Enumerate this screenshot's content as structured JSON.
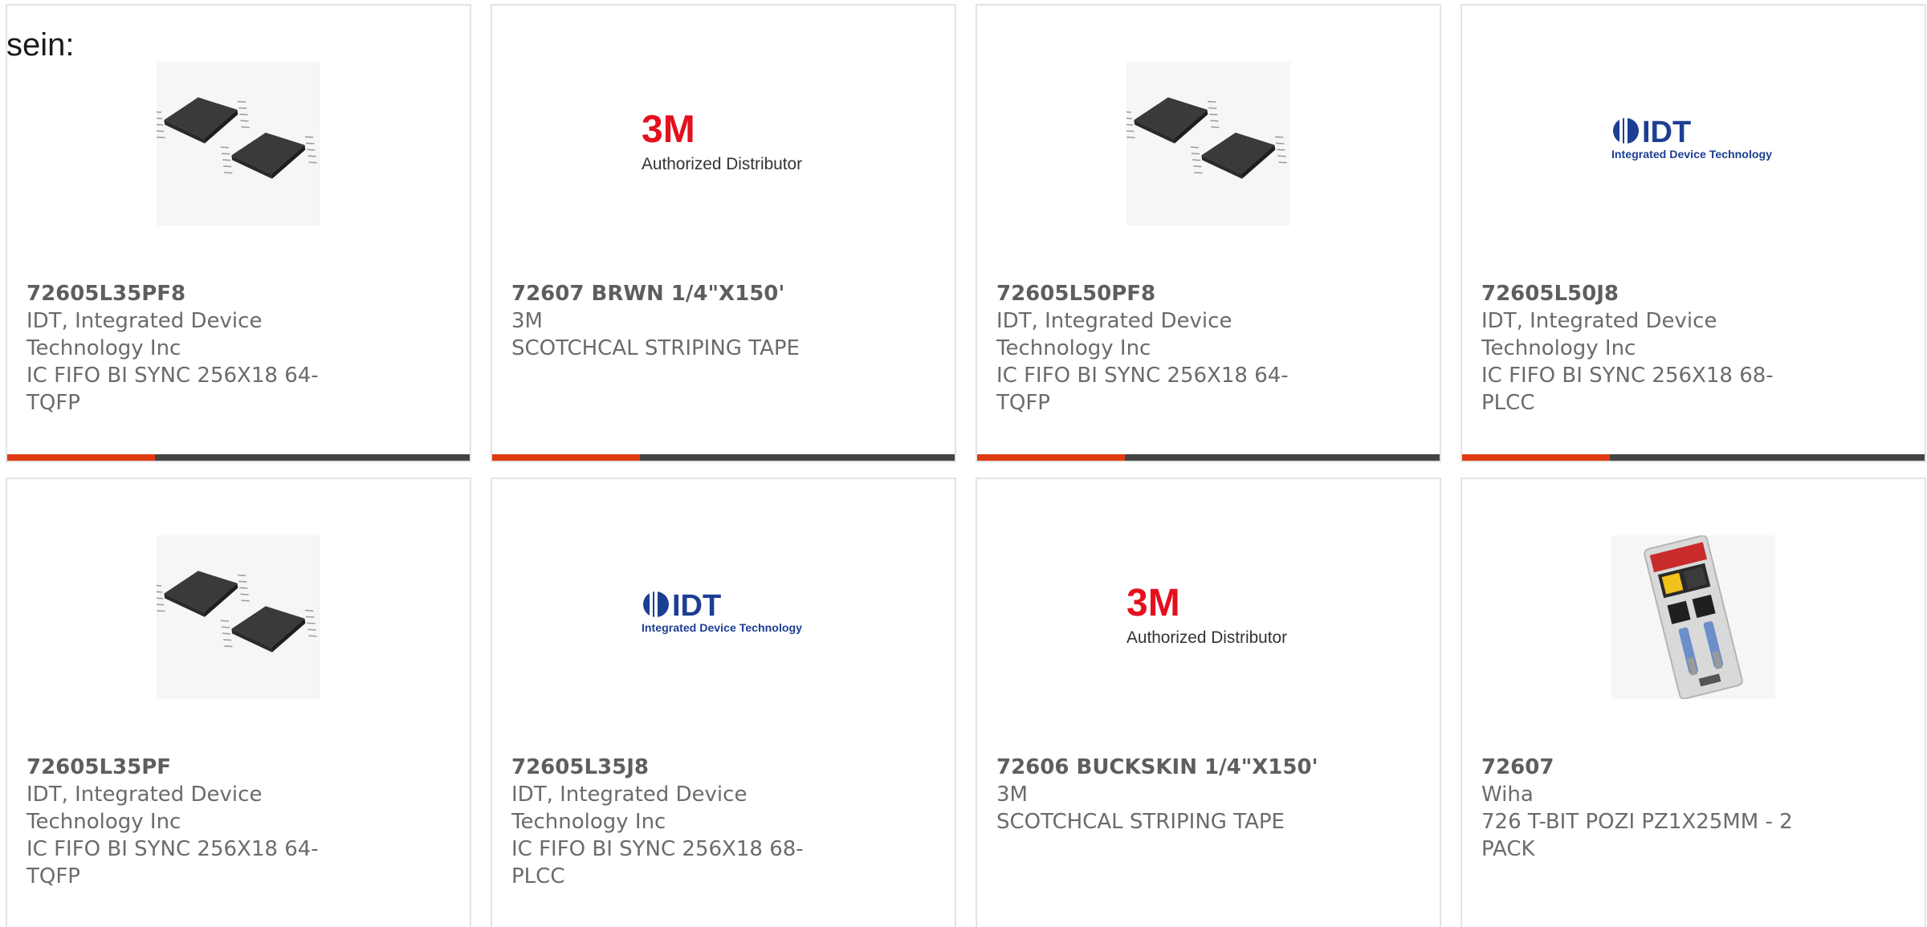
{
  "stray_text": "sein:",
  "colors": {
    "accent": "#e03c13",
    "bar_track": "#444444",
    "card_border": "#e3e3e3",
    "text": "#6b6b6b",
    "brand_3m_red": "#e4101e",
    "brand_idt_blue": "#1d3f93"
  },
  "cards": [
    {
      "part_number": "72605L35PF8",
      "manufacturer": "IDT, Integrated Device Technology Inc",
      "description": "IC FIFO BI SYNC 256X18 64-TQFP",
      "image": "chip-package",
      "progress": 0.32
    },
    {
      "part_number": "72607 BRWN 1/4\"X150'",
      "manufacturer": "3M",
      "description": "SCOTCHCAL STRIPING TAPE",
      "image": "3m-logo",
      "logo_mark": "3M",
      "logo_text": "Authorized Distributor",
      "progress": 0.32
    },
    {
      "part_number": "72605L50PF8",
      "manufacturer": "IDT, Integrated Device Technology Inc",
      "description": "IC FIFO BI SYNC 256X18 64-TQFP",
      "image": "chip-package",
      "progress": 0.32
    },
    {
      "part_number": "72605L50J8",
      "manufacturer": "IDT, Integrated Device Technology Inc",
      "description": "IC FIFO BI SYNC 256X18 68-PLCC",
      "image": "idt-logo",
      "logo_mark": "IDT",
      "logo_text": "Integrated Device Technology",
      "progress": 0.32
    },
    {
      "part_number": "72605L35PF",
      "manufacturer": "IDT, Integrated Device Technology Inc",
      "description": "IC FIFO BI SYNC 256X18 64-TQFP",
      "image": "chip-package"
    },
    {
      "part_number": "72605L35J8",
      "manufacturer": "IDT, Integrated Device Technology Inc",
      "description": "IC FIFO BI SYNC 256X18 68-PLCC",
      "image": "idt-logo",
      "logo_mark": "IDT",
      "logo_text": "Integrated Device Technology"
    },
    {
      "part_number": "72606 BUCKSKIN 1/4\"X150'",
      "manufacturer": "3M",
      "description": "SCOTCHCAL STRIPING TAPE",
      "image": "3m-logo",
      "logo_mark": "3M",
      "logo_text": "Authorized Distributor"
    },
    {
      "part_number": "72607",
      "manufacturer": "Wiha",
      "description": "726 T-BIT POZI PZ1X25MM - 2 PACK",
      "image": "bit-pack"
    }
  ]
}
